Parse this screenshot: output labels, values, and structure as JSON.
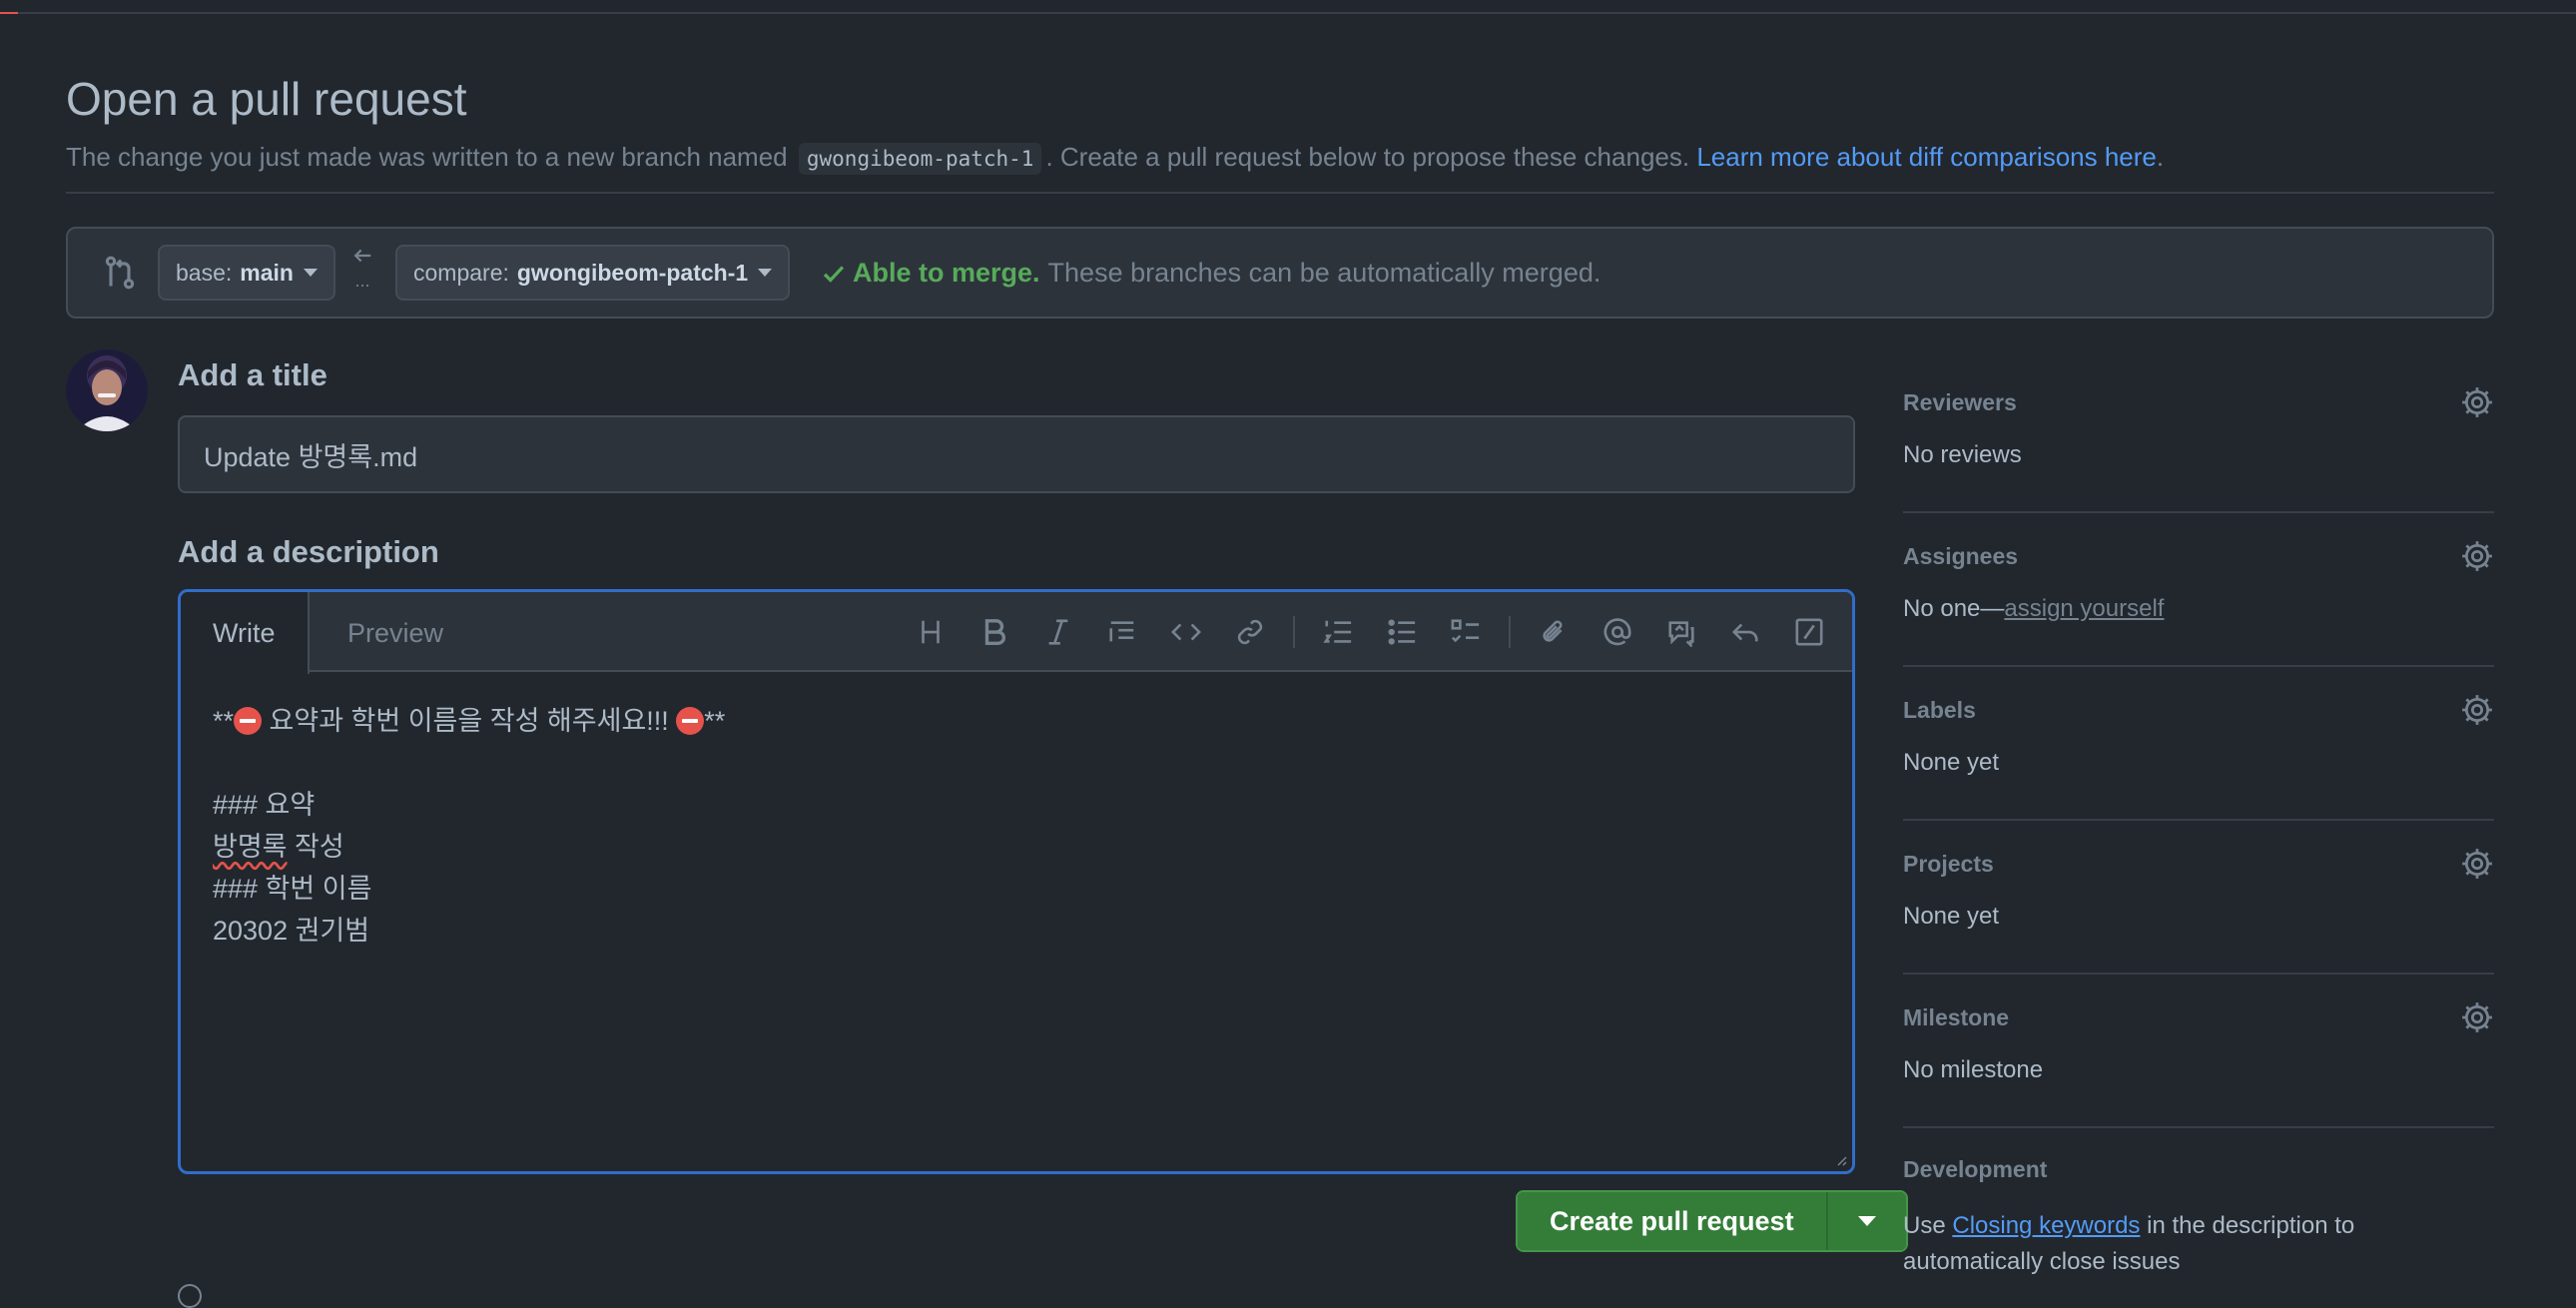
{
  "header": {
    "title": "Open a pull request",
    "subhead_before": "The change you just made was written to a new branch named",
    "branch_name": "gwongibeom-patch-1",
    "subhead_after": ". Create a pull request below to propose these changes.",
    "learn_link": "Learn more about diff comparisons here",
    "learn_tail": "."
  },
  "range": {
    "base_key": "base:",
    "base_value": "main",
    "swap_ellipsis": "...",
    "compare_key": "compare:",
    "compare_value": "gwongibeom-patch-1",
    "merge_ok": "Able to merge.",
    "merge_desc": "These branches can be automatically merged."
  },
  "form": {
    "title_label": "Add a title",
    "title_value": "Update 방명록.md",
    "desc_label": "Add a description",
    "tab_write": "Write",
    "tab_preview": "Preview",
    "body_line1_pre": "**",
    "body_line1_mid": " 요약과 학번 이름을 작성 해주세요!!! ",
    "body_line1_post": "**",
    "body_line3": "### 요약",
    "body_line4_a": "방명록",
    "body_line4_b": " 작성",
    "body_line5": "### 학번 이름",
    "body_line6": "20302 권기범",
    "toolbar_icons": [
      "heading-icon",
      "bold-icon",
      "italic-icon",
      "quote-icon",
      "code-icon",
      "link-icon",
      "numbered-list-icon",
      "unordered-list-icon",
      "task-list-icon",
      "attach-icon",
      "mention-icon",
      "reference-icon",
      "reply-icon",
      "slash-command-icon"
    ],
    "create_label": "Create pull request"
  },
  "sidebar": {
    "reviewers": {
      "label": "Reviewers",
      "value": "No reviews"
    },
    "assignees": {
      "label": "Assignees",
      "value": "No one—",
      "link": "assign yourself"
    },
    "labels": {
      "label": "Labels",
      "value": "None yet"
    },
    "projects": {
      "label": "Projects",
      "value": "None yet"
    },
    "milestone": {
      "label": "Milestone",
      "value": "No milestone"
    },
    "development": {
      "label": "Development",
      "pre": "Use ",
      "link": "Closing keywords",
      "post": " in the description to automatically close issues"
    }
  },
  "colors": {
    "accent": "#539bf5",
    "success": "#57ab5a",
    "button": "#347d39",
    "focus": "#316dca"
  }
}
